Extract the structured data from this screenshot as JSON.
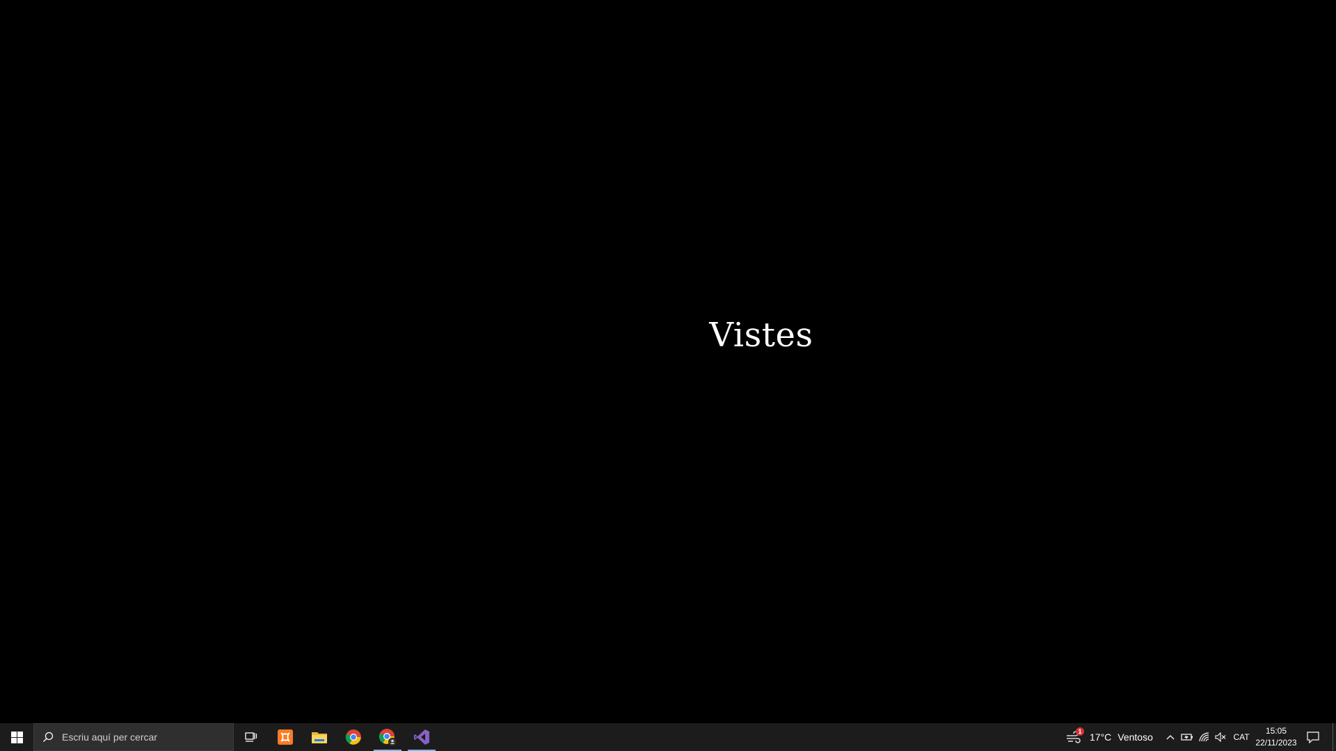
{
  "desktop": {
    "center_text": "Vistes"
  },
  "taskbar": {
    "search_placeholder": "Escriu aquí per cercar",
    "pinned_apps": [
      {
        "name": "Task View",
        "icon": "task-view-icon"
      },
      {
        "name": "XAMPP",
        "icon": "xampp-icon"
      },
      {
        "name": "File Explorer",
        "icon": "file-explorer-icon"
      },
      {
        "name": "Google Chrome",
        "icon": "chrome-icon"
      },
      {
        "name": "Google Chrome (profile)",
        "icon": "chrome-profile-icon"
      },
      {
        "name": "Visual Studio",
        "icon": "visual-studio-icon"
      }
    ],
    "weather": {
      "badge": "1",
      "temperature": "17°C",
      "condition": "Ventoso"
    },
    "tray": {
      "language": "CAT",
      "time": "15:05",
      "date": "22/11/2023"
    },
    "colors": {
      "taskbar_bg": "#1c1c1c",
      "active_indicator": "#76b9ed",
      "xampp_orange": "#fb7a24",
      "vs_purple": "#8661c5"
    }
  }
}
